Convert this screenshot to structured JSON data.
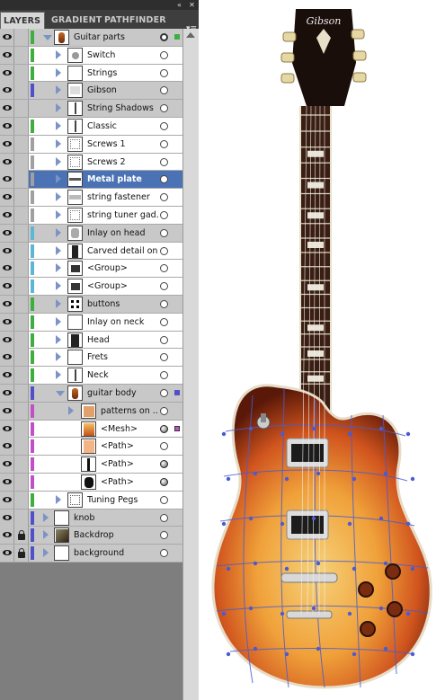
{
  "panel": {
    "tabs": [
      "LAYERS",
      "GRADIENT",
      "PATHFINDER"
    ],
    "topbar": {
      "collapse_icon": "double-chevron-icon",
      "close_icon": "close-icon"
    },
    "menu_icon": "panel-menu-icon"
  },
  "layers": [
    {
      "label": "Guitar parts",
      "indent": 0,
      "twirl": "open",
      "thumb": "guitar",
      "bar": "#3fae3f",
      "grp": true,
      "target": "ring",
      "sq": "#3fae3f"
    },
    {
      "label": "Switch",
      "indent": 1,
      "twirl": "closed",
      "thumb": "switch",
      "bar": "#3fae3f"
    },
    {
      "label": "Strings",
      "indent": 1,
      "twirl": "closed",
      "thumb": "blank",
      "bar": "#3fae3f"
    },
    {
      "label": "Gibson",
      "indent": 1,
      "twirl": "closed",
      "thumb": "gibson",
      "bar": "#5050c8",
      "grp": true
    },
    {
      "label": "String Shadows",
      "indent": 1,
      "twirl": "closed",
      "thumb": "line",
      "bar": "#c8c8c8",
      "grp": true
    },
    {
      "label": "Classic",
      "indent": 1,
      "twirl": "closed",
      "thumb": "line",
      "bar": "#3fae3f"
    },
    {
      "label": "Screws 1",
      "indent": 1,
      "twirl": "closed",
      "thumb": "dots",
      "bar": "#a0a0a0"
    },
    {
      "label": "Screws 2",
      "indent": 1,
      "twirl": "closed",
      "thumb": "dots",
      "bar": "#a0a0a0"
    },
    {
      "label": "Metal plate",
      "indent": 1,
      "twirl": "closed",
      "thumb": "plate",
      "bar": "#a0a0a0",
      "sel": true
    },
    {
      "label": "string fastener",
      "indent": 1,
      "twirl": "closed",
      "thumb": "fast",
      "bar": "#a0a0a0"
    },
    {
      "label": "string tuner gad...",
      "indent": 1,
      "twirl": "closed",
      "thumb": "dots",
      "bar": "#a0a0a0"
    },
    {
      "label": "Inlay on head",
      "indent": 1,
      "twirl": "closed",
      "thumb": "inlay",
      "bar": "#5fb5d6",
      "grp": true
    },
    {
      "label": "Carved detail on...",
      "indent": 1,
      "twirl": "closed",
      "thumb": "carved",
      "bar": "#5fb5d6"
    },
    {
      "label": "<Group>",
      "indent": 1,
      "twirl": "closed",
      "thumb": "darkbar",
      "bar": "#5fb5d6"
    },
    {
      "label": "<Group>",
      "indent": 1,
      "twirl": "closed",
      "thumb": "darkbar",
      "bar": "#5fb5d6"
    },
    {
      "label": "buttons",
      "indent": 1,
      "twirl": "closed",
      "thumb": "buttons",
      "bar": "#3fae3f",
      "grp": true
    },
    {
      "label": "Inlay on neck",
      "indent": 1,
      "twirl": "closed",
      "thumb": "blank",
      "bar": "#3fae3f"
    },
    {
      "label": "Head",
      "indent": 1,
      "twirl": "closed",
      "thumb": "head",
      "bar": "#3fae3f"
    },
    {
      "label": "Frets",
      "indent": 1,
      "twirl": "closed",
      "thumb": "blank",
      "bar": "#3fae3f"
    },
    {
      "label": "Neck",
      "indent": 1,
      "twirl": "closed",
      "thumb": "line",
      "bar": "#3fae3f"
    },
    {
      "label": "guitar body",
      "indent": 1,
      "twirl": "open",
      "thumb": "guitar",
      "bar": "#5050c8",
      "grp": true,
      "sq": "#5050c8"
    },
    {
      "label": "patterns on ...",
      "indent": 2,
      "twirl": "closed",
      "thumb": "patterns",
      "bar": "#c050c8",
      "grp": true
    },
    {
      "label": "<Mesh>",
      "indent": 3,
      "twirl": "none",
      "thumb": "mesh",
      "bar": "#c050c8",
      "target": "filled",
      "sq": "#c050c8"
    },
    {
      "label": "<Path>",
      "indent": 3,
      "twirl": "none",
      "thumb": "peach",
      "bar": "#c050c8"
    },
    {
      "label": "<Path>",
      "indent": 3,
      "twirl": "none",
      "thumb": "blackline",
      "bar": "#c050c8",
      "target": "filled"
    },
    {
      "label": "<Path>",
      "indent": 3,
      "twirl": "none",
      "thumb": "blackbody",
      "bar": "#c050c8",
      "target": "filled"
    },
    {
      "label": "Tuning Pegs",
      "indent": 1,
      "twirl": "closed",
      "thumb": "pegs",
      "bar": "#3fae3f"
    },
    {
      "label": "knob",
      "indent": 0,
      "twirl": "closed",
      "thumb": "blank",
      "bar": "#5050c8",
      "grp": true
    },
    {
      "label": "Backdrop",
      "indent": 0,
      "twirl": "closed",
      "thumb": "backdrop",
      "bar": "#5050c8",
      "grp": true,
      "locked": true
    },
    {
      "label": "background",
      "indent": 0,
      "twirl": "closed",
      "thumb": "blank",
      "bar": "#5050c8",
      "grp": true,
      "locked": true
    }
  ],
  "guitar": {
    "brand": "Gibson"
  },
  "colors": {
    "selection": "#4a72b5",
    "mesh_points": "#4b5bd0"
  }
}
